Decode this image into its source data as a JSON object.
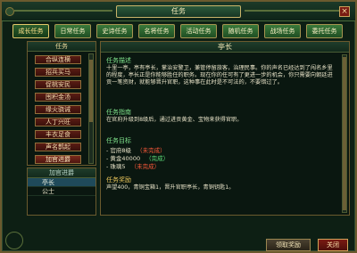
{
  "window": {
    "title": "任务",
    "close_glyph": "×"
  },
  "tabs": [
    {
      "label": "成长任务",
      "active": true
    },
    {
      "label": "日常任务",
      "active": false
    },
    {
      "label": "史诗任务",
      "active": false
    },
    {
      "label": "名将任务",
      "active": false
    },
    {
      "label": "活动任务",
      "active": false
    },
    {
      "label": "随机任务",
      "active": false
    },
    {
      "label": "战场任务",
      "active": false
    },
    {
      "label": "委托任务",
      "active": false
    }
  ],
  "left": {
    "header": "任务",
    "items": [
      "合纵连横",
      "招兵买马",
      "促桃安民",
      "囤积金汤",
      "缘火骁诫",
      "人丁兴旺",
      "丰衣足食",
      "声名鹊起",
      "加官进爵"
    ],
    "selected_index": 8
  },
  "sub": {
    "header": "加官进爵",
    "rows": [
      "亭长",
      "公士"
    ],
    "selected_index": 0
  },
  "detail": {
    "title": "亭长",
    "desc_label": "任务描述",
    "desc_text": "十里一亭，亭有亭长，掌治安警卫，兼管停留旅客，治理民事。你的声名已经达到了闯名乡里的程度，亭长正是你能够胜任的职务。现在你的任可有了更进一步的机会，你只需要向朝廷进贡一笔资财，就能够晋升官职，这种事在此时是不可法的，不要错过了。",
    "guide_label": "任务指南",
    "guide_text": "在官府升级到8级后，通过进贡黄金、宝物来获得官职。",
    "goal_label": "任务目标",
    "goals": [
      {
        "text": "- 官府8级",
        "status": "（未完成）",
        "done": false
      },
      {
        "text": "- 黄金40000",
        "status": "（完成）",
        "done": true
      },
      {
        "text": "- 珠璃5",
        "status": "（未完成）",
        "done": false
      }
    ],
    "reward_label": "任务奖励",
    "reward_text": "声望400，青铜宝箱1，晋升官职亭长，青铜钥匙1。"
  },
  "buttons": {
    "claim": "领取奖励",
    "close": "关闭"
  },
  "colors": {
    "accent_green": "#7ee08a",
    "gold": "#e8c45a",
    "incomplete_red": "#ff5a3a",
    "complete_green": "#5ee07a"
  }
}
